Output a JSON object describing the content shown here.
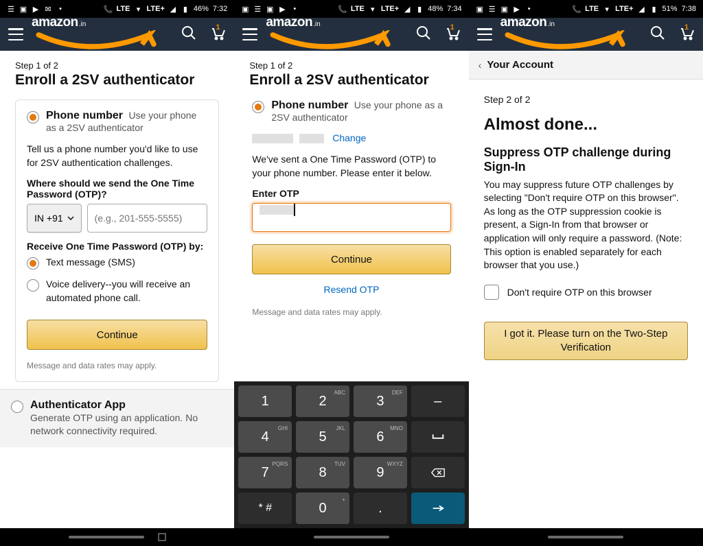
{
  "statusbars": {
    "s1": {
      "battery": "46%",
      "time": "7:32"
    },
    "s2": {
      "battery": "48%",
      "time": "7:34"
    },
    "s3": {
      "battery": "51%",
      "time": "7:38"
    }
  },
  "header": {
    "logo_main": "amazon",
    "logo_tld": ".in",
    "cart_badge": "1"
  },
  "screen1": {
    "step": "Step 1 of 2",
    "title": "Enroll a 2SV authenticator",
    "option_title": "Phone number",
    "option_sub": "Use your phone as a 2SV authenticator",
    "intro": "Tell us a phone number you'd like to use for 2SV authentication challenges.",
    "send_label": "Where should we send the One Time Password (OTP)?",
    "country_code": "IN +91",
    "phone_placeholder": "(e.g., 201-555-5555)",
    "receive_label": "Receive One Time Password (OTP) by:",
    "method_sms": "Text message (SMS)",
    "method_voice": "Voice delivery--you will receive an automated phone call.",
    "continue": "Continue",
    "rates_note": "Message and data rates may apply.",
    "app_title": "Authenticator App",
    "app_sub": "Generate OTP using an application. No network connectivity required."
  },
  "screen2": {
    "step": "Step 1 of 2",
    "title": "Enroll a 2SV authenticator",
    "option_title": "Phone number",
    "option_sub": "Use your phone as a 2SV authenticator",
    "change": "Change",
    "sent": "We've sent a One Time Password (OTP) to your phone number. Please enter it below.",
    "enter_otp": "Enter OTP",
    "continue": "Continue",
    "resend": "Resend OTP",
    "rates_note": "Message and data rates may apply."
  },
  "screen3": {
    "crumb": "Your Account",
    "step": "Step 2 of 2",
    "title": "Almost done...",
    "subtitle": "Suppress OTP challenge during Sign-In",
    "body": "You may suppress future OTP challenges by selecting \"Don't require OTP on this browser\". As long as the OTP suppression cookie is present, a Sign-In from that browser or application will only require a password. (Note: This option is enabled separately for each browser that you use.)",
    "checkbox_label": "Don't require OTP on this browser",
    "got_it": "I got it. Please turn on the Two-Step Verification"
  },
  "keyboard": {
    "keys": [
      {
        "n": "1",
        "s": ""
      },
      {
        "n": "2",
        "s": "ABC"
      },
      {
        "n": "3",
        "s": "DEF"
      },
      {
        "n": "-",
        "s": ""
      },
      {
        "n": "4",
        "s": "GHI"
      },
      {
        "n": "5",
        "s": "JKL"
      },
      {
        "n": "6",
        "s": "MNO"
      },
      {
        "n": "␣",
        "s": ""
      },
      {
        "n": "7",
        "s": "PQRS"
      },
      {
        "n": "8",
        "s": "TUV"
      },
      {
        "n": "9",
        "s": "WXYZ"
      },
      {
        "n": "⌫",
        "s": ""
      },
      {
        "n": "* #",
        "s": ""
      },
      {
        "n": "0",
        "s": "+"
      },
      {
        "n": ".",
        "s": ""
      },
      {
        "n": "→",
        "s": ""
      }
    ]
  }
}
